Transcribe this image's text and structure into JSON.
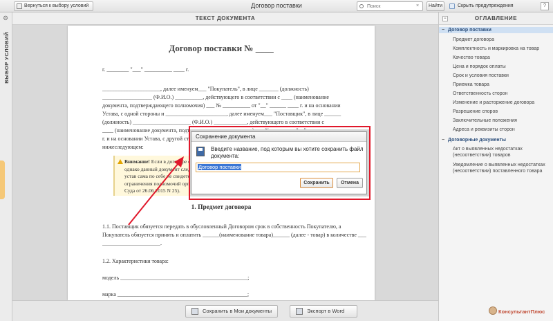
{
  "topbar": {
    "back_label": "Вернуться к выбору условий",
    "title": "Договор поставки",
    "search_placeholder": "Поиск",
    "find_label": "Найти",
    "hide_warnings_label": "Скрыть предупреждения",
    "help_label": "?"
  },
  "left_tab": {
    "label": "ВЫБОР УСЛОВИЙ"
  },
  "doc_header": {
    "title": "ТЕКСТ ДОКУМЕНТА"
  },
  "document": {
    "title": "Договор поставки № ____",
    "lines": [
      "г. ________                                                                                    \"___\" __________ ____ г.",
      "_____________________, далее именуем___ \"Покупатель\", в лице _______ (должность)",
      "__________________ (Ф.И.О.) __________, действующего в соответствии с ____ (наименование",
      "документа, подтверждающего полномочия) ___ № __________ от \"__\" ______ ____ г. и на основании",
      "Устава, с одной стороны и ______________________, далее именуем___ \"Поставщик\", в лице ______",
      "(должность) _____________________ (Ф.И.О.) ____________, действующего в соответствии с",
      "____ (наименование документа, подтверждающего полномочия) ___ № ______ от \"__\" ______",
      "г. и на основании Устава, с другой стороны, заключили настоящий Договор о",
      "нижеследующем:"
    ],
    "note_title": "Внимание!",
    "note_lines": [
      "Если в договоре есть ссылка на документ, то его необходимо проверить,",
      "однако данный документ следует приложить к договору. Документ, подтверждающий",
      "устав сама по себе не свидетельствует о наличии полномочий, но устанавливает",
      "ограничения полномочий органов управления организации (Определение ВС РФ",
      "Суда от 26.06.2015 N 25)."
    ],
    "section_title": "1.  Предмет договора",
    "sec_lines": [
      "1.1.  Поставщик обязуется передать в обусловленный Договором срок в собственность Покупателю, а",
      "Покупатель обязуется принять и оплатить ______(наименование товара)______ (далее - товар) в количестве _____",
      "_____________________.",
      "1.2.  Характеристики товара:",
      "модель ______________________________________________;",
      "марка _______________________________________________;"
    ]
  },
  "bottom": {
    "save_label": "Сохранить в Мои документы",
    "export_label": "Экспорт в Word"
  },
  "toc": {
    "header": "ОГЛАВЛЕНИЕ",
    "collapse_label": "−",
    "group1": "Договор поставки",
    "items": [
      "Предмет договора",
      "Комплектность и маркировка на товар",
      "Качество товара",
      "Цена и порядок оплаты",
      "Срок и условия поставки",
      "Приемка товара",
      "Ответственность сторон",
      "Изменение и расторжение договора",
      "Разрешение споров",
      "Заключительные положения",
      "Адреса и реквизиты сторон"
    ],
    "group2": "Договорные документы",
    "items2": [
      "Акт о выявленных недостатках (несоответствии) товаров",
      "Уведомление о выявленных недостатках (несоответствии) поставленного товара"
    ],
    "logo": "КонсультантПлюс"
  },
  "dialog": {
    "title": "Сохранение документа",
    "prompt": "Введите название, под которым вы хотите сохранить файл документа:",
    "input_value": "Договор поставки",
    "save_label": "Сохранить",
    "cancel_label": "Отмена"
  },
  "colors": {
    "highlight": "#e0172a",
    "accent": "#2a4d7a"
  }
}
